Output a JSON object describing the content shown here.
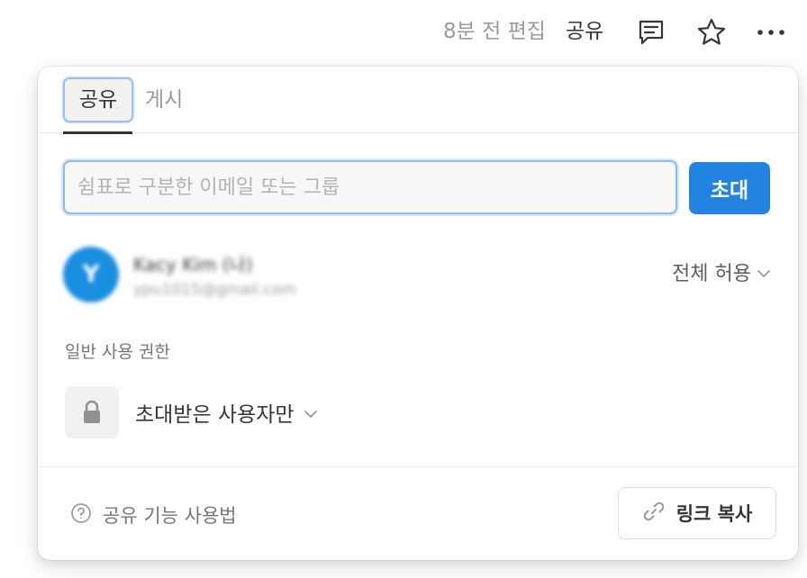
{
  "topbar": {
    "edited_text": "8분 전 편집",
    "share_label": "공유",
    "icons": {
      "comment": "comment-icon",
      "favorite": "star-icon",
      "more": "more-icon"
    }
  },
  "popover": {
    "tabs": [
      {
        "label": "공유",
        "active": true
      },
      {
        "label": "게시",
        "active": false
      }
    ],
    "invite": {
      "placeholder": "쉼표로 구분한 이메일 또는 그룹",
      "value": "",
      "button_label": "초대"
    },
    "member": {
      "avatar_initial": "Y",
      "name": "Kacy Kim (나)",
      "email": "ypu1015@gmail.com",
      "access_level": "전체 허용"
    },
    "general_access": {
      "section_label": "일반 사용 권한",
      "value": "초대받은 사용자만",
      "icon": "lock-icon"
    },
    "footer": {
      "help_label": "공유 기능 사용법",
      "copy_link_label": "링크 복사"
    }
  },
  "colors": {
    "accent": "#2383e2",
    "avatar": "#1a8fe0",
    "text_primary": "#37352f",
    "text_secondary": "#9b9a97"
  }
}
